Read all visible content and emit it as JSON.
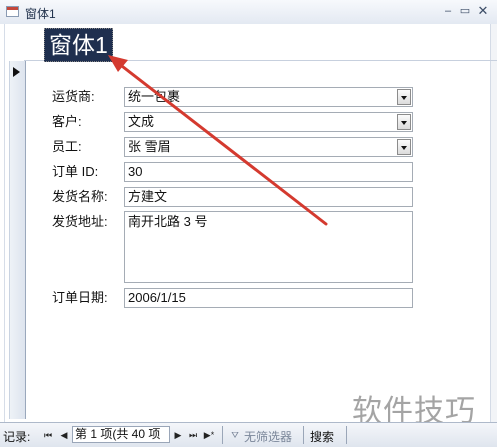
{
  "window": {
    "title": "窗体1"
  },
  "form": {
    "header_title": "窗体1",
    "fields": [
      {
        "label": "运货商:",
        "value": "统一包裹",
        "kind": "combo"
      },
      {
        "label": "客户:",
        "value": "文成",
        "kind": "combo"
      },
      {
        "label": "员工:",
        "value": "张 雪眉",
        "kind": "combo"
      },
      {
        "label": "订单 ID:",
        "value": "30",
        "kind": "text"
      },
      {
        "label": "发货名称:",
        "value": "方建文",
        "kind": "text"
      },
      {
        "label": "发货地址:",
        "value": "南开北路 3 号",
        "kind": "memo"
      },
      {
        "label": "订单日期:",
        "value": "2006/1/15",
        "kind": "text"
      }
    ]
  },
  "navbar": {
    "record_label": "记录:",
    "position": "第 1 项(共 40 项",
    "filter_label": "无筛选器",
    "search_label": "搜索"
  },
  "watermark": "软件技巧",
  "annotation": {
    "color": "#d43a2f"
  }
}
